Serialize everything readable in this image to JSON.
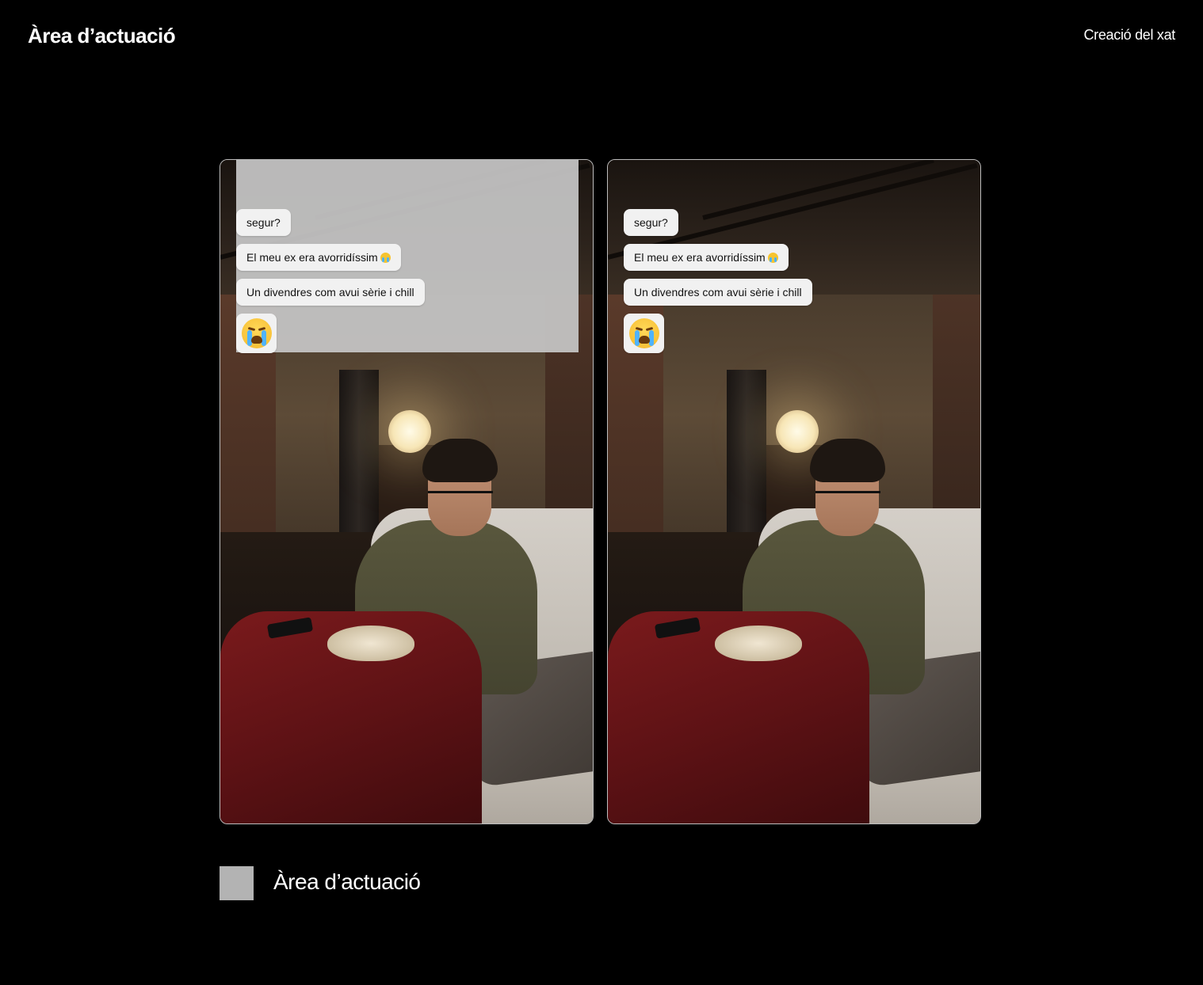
{
  "header": {
    "title": "Àrea d’actuació",
    "section": "Creació del xat"
  },
  "frames": [
    {
      "id": "with-action-area",
      "highlight_action_area": true,
      "messages": [
        "segur?",
        "El meu ex era avorridíssim",
        "Un divendres com avui sèrie i chill"
      ],
      "emoji": "loudly-crying-face-icon"
    },
    {
      "id": "plain",
      "highlight_action_area": false,
      "messages": [
        "segur?",
        "El meu ex era avorridíssim",
        "Un divendres com avui sèrie i chill"
      ],
      "emoji": "loudly-crying-face-icon"
    }
  ],
  "legend": {
    "swatch_color": "#b3b3b3",
    "label": "Àrea d’actuació"
  },
  "colors": {
    "background": "#000000",
    "action_area": "#c6c6c6",
    "bubble": "#f1f1f1",
    "blanket": "#6b1518"
  }
}
